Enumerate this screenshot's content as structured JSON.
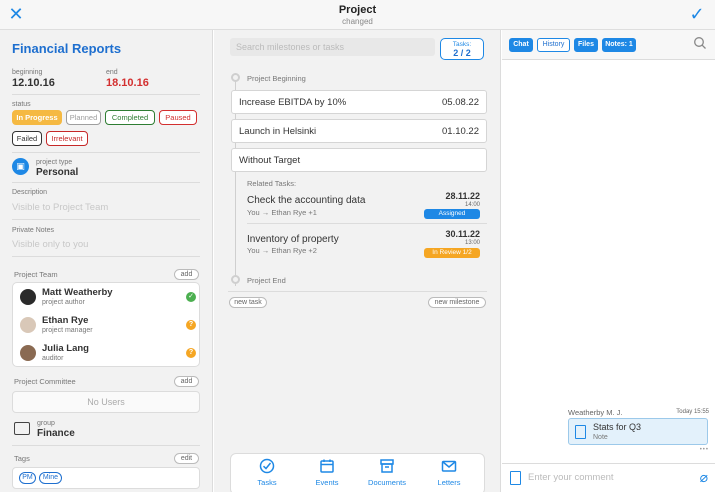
{
  "header": {
    "title": "Project",
    "subtitle": "changed"
  },
  "project": {
    "title": "Financial Reports",
    "beginning_label": "beginning",
    "beginning": "12.10.16",
    "end_label": "end",
    "end": "18.10.16",
    "status_label": "status",
    "statuses": [
      {
        "label": "In Progress",
        "color": "#f5b942",
        "selected": true
      },
      {
        "label": "Planned",
        "color": "#9e9e9e"
      },
      {
        "label": "Completed",
        "color": "#2e7d32"
      },
      {
        "label": "Paused",
        "color": "#d32f2f"
      },
      {
        "label": "Failed",
        "color": "#333333"
      },
      {
        "label": "Irrelevant",
        "color": "#c62828"
      }
    ],
    "type_label": "project type",
    "type_value": "Personal",
    "description_label": "Description",
    "description_placeholder": "Visible to Project Team",
    "private_notes_label": "Private Notes",
    "private_notes_placeholder": "Visible only to you",
    "team_label": "Project Team",
    "team_add": "add",
    "team": [
      {
        "name": "Matt Weatherby",
        "role": "project author",
        "status_color": "#4caf50",
        "status_icon": "check-icon"
      },
      {
        "name": "Ethan Rye",
        "role": "project manager",
        "status_color": "#f5a623",
        "status_icon": "question-icon"
      },
      {
        "name": "Julia Lang",
        "role": "auditor",
        "status_color": "#f5a623",
        "status_icon": "question-icon"
      }
    ],
    "committee_label": "Project Committee",
    "committee_add": "add",
    "committee_empty": "No Users",
    "group_label": "group",
    "group_value": "Finance",
    "tags_label": "Tags",
    "tags_edit": "edit",
    "tags": [
      "PM",
      "Mine"
    ]
  },
  "milestones": {
    "search_placeholder": "Search milestones or tasks",
    "tasks_badge_label": "Tasks:",
    "tasks_badge_value": "2 / 2",
    "beginning": "Project Beginning",
    "items": [
      {
        "name": "Increase EBITDA by 10%",
        "date": "05.08.22"
      },
      {
        "name": "Launch in Helsinki",
        "date": "01.10.22"
      },
      {
        "name": "Without Target",
        "date": ""
      }
    ],
    "related_label": "Related Tasks:",
    "tasks": [
      {
        "name": "Check the accounting data",
        "who": "You → Ethan Rye +1",
        "date": "28.11.22",
        "time": "14:00",
        "badge": "Assigned",
        "badge_color": "#1e88e5"
      },
      {
        "name": "Inventory of property",
        "who": "You → Ethan Rye +2",
        "date": "30.11.22",
        "time": "13:00",
        "badge": "In Review 1/2",
        "badge_color": "#f5a623"
      }
    ],
    "end": "Project End",
    "new_task": "new task",
    "new_milestone": "new milestone"
  },
  "bottom_nav": [
    {
      "label": "Tasks",
      "icon": "check-circle-icon"
    },
    {
      "label": "Events",
      "icon": "calendar-icon"
    },
    {
      "label": "Documents",
      "icon": "documents-icon"
    },
    {
      "label": "Letters",
      "icon": "envelope-icon"
    }
  ],
  "right_panel": {
    "tabs": [
      {
        "label": "Chat",
        "active": true
      },
      {
        "label": "History",
        "active": false
      },
      {
        "label": "Files",
        "active": true
      },
      {
        "label": "Notes: 1",
        "active": true
      }
    ],
    "message": {
      "author": "Weatherby M. J.",
      "time": "Today 15:55",
      "title": "Stats for Q3",
      "kind": "Note"
    },
    "more": "•••",
    "comment_placeholder": "Enter your comment"
  },
  "colors": {
    "accent": "#1e88e5",
    "red": "#d32f2f",
    "gold": "#f5b942"
  }
}
